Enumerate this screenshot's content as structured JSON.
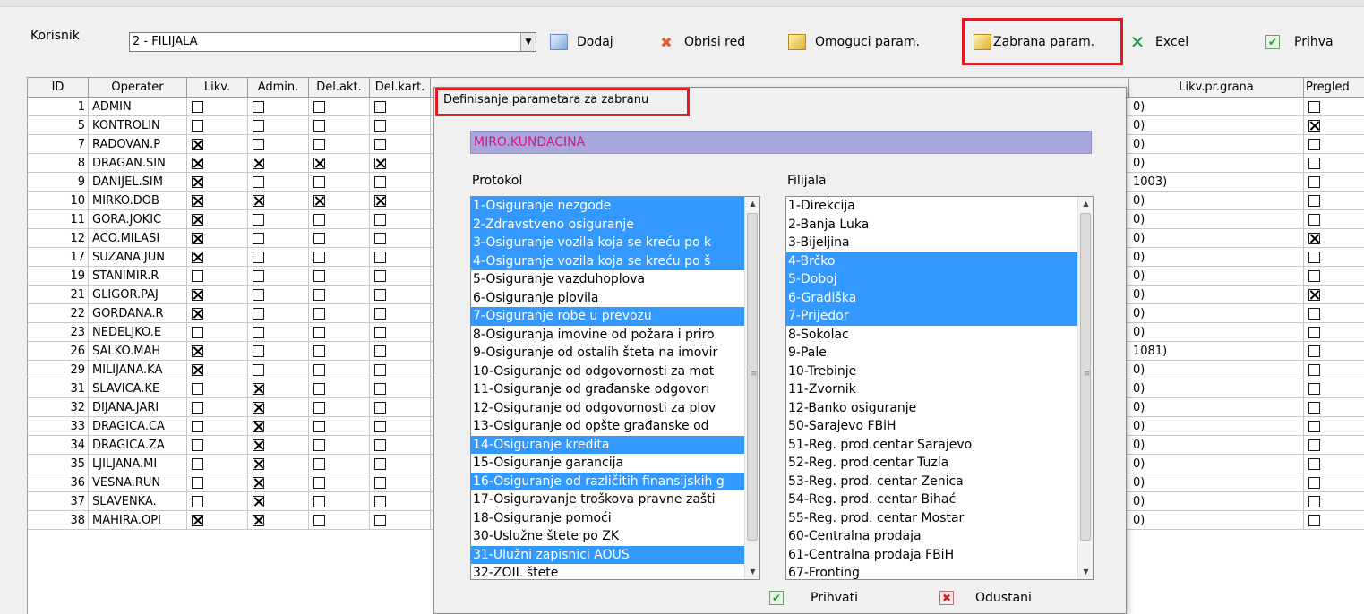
{
  "toolbar": {
    "korisnik_label": "Korisnik",
    "combo_value": "2 - FILIJALA",
    "buttons": {
      "dodaj": "Dodaj",
      "obrisi_red": "Obrisi red",
      "omoguci_param": "Omoguci param.",
      "zabrana_param": "Zabrana param.",
      "excel": "Excel",
      "prihvati": "Prihva"
    }
  },
  "grid": {
    "headers": {
      "id": "ID",
      "operater": "Operater",
      "likv": "Likv.",
      "admin": "Admin.",
      "del_akt": "Del.akt.",
      "del_kart": "Del.kart.",
      "likv_pr_grana": "Likv.pr.grana",
      "pregled": "Pregled"
    },
    "rows": [
      {
        "id": "1",
        "op": "ADMIN",
        "likv": false,
        "admin": false,
        "delakt": false,
        "delkart": false,
        "grana": "0)",
        "pregled": false
      },
      {
        "id": "5",
        "op": "KONTROLIN",
        "likv": false,
        "admin": false,
        "delakt": false,
        "delkart": false,
        "grana": "0)",
        "pregled": true
      },
      {
        "id": "7",
        "op": "RADOVAN.P",
        "likv": true,
        "admin": false,
        "delakt": false,
        "delkart": false,
        "grana": "0)",
        "pregled": false
      },
      {
        "id": "8",
        "op": "DRAGAN.SIN",
        "likv": true,
        "admin": true,
        "delakt": true,
        "delkart": true,
        "grana": "0)",
        "pregled": false
      },
      {
        "id": "9",
        "op": "DANIJEL.SIM",
        "likv": true,
        "admin": false,
        "delakt": false,
        "delkart": false,
        "grana": "1003)",
        "pregled": false
      },
      {
        "id": "10",
        "op": "MIRKO.DOB",
        "likv": true,
        "admin": true,
        "delakt": true,
        "delkart": true,
        "grana": "0)",
        "pregled": false
      },
      {
        "id": "11",
        "op": "GORA.JOKIC",
        "likv": true,
        "admin": false,
        "delakt": false,
        "delkart": false,
        "grana": "0)",
        "pregled": false
      },
      {
        "id": "12",
        "op": "ACO.MILASI",
        "likv": true,
        "admin": false,
        "delakt": false,
        "delkart": false,
        "grana": "0)",
        "pregled": true
      },
      {
        "id": "17",
        "op": "SUZANA.JUN",
        "likv": true,
        "admin": false,
        "delakt": false,
        "delkart": false,
        "grana": "0)",
        "pregled": false
      },
      {
        "id": "19",
        "op": "STANIMIR.R",
        "likv": false,
        "admin": false,
        "delakt": false,
        "delkart": false,
        "grana": "0)",
        "pregled": false
      },
      {
        "id": "21",
        "op": "GLIGOR.PAJ",
        "likv": true,
        "admin": false,
        "delakt": false,
        "delkart": false,
        "grana": "0)",
        "pregled": true
      },
      {
        "id": "22",
        "op": "GORDANA.R",
        "likv": true,
        "admin": false,
        "delakt": false,
        "delkart": false,
        "grana": "0)",
        "pregled": false
      },
      {
        "id": "23",
        "op": "NEDELJKO.E",
        "likv": false,
        "admin": false,
        "delakt": false,
        "delkart": false,
        "grana": "0)",
        "pregled": false
      },
      {
        "id": "26",
        "op": "SALKO.MAH",
        "likv": true,
        "admin": false,
        "delakt": false,
        "delkart": false,
        "grana": "1081)",
        "pregled": false
      },
      {
        "id": "29",
        "op": "MILIJANA.KA",
        "likv": true,
        "admin": false,
        "delakt": false,
        "delkart": false,
        "grana": "0)",
        "pregled": false
      },
      {
        "id": "31",
        "op": "SLAVICA.KE",
        "likv": false,
        "admin": true,
        "delakt": false,
        "delkart": false,
        "grana": "0)",
        "pregled": false
      },
      {
        "id": "32",
        "op": "DIJANA.JARI",
        "likv": false,
        "admin": true,
        "delakt": false,
        "delkart": false,
        "grana": "0)",
        "pregled": false
      },
      {
        "id": "33",
        "op": "DRAGICA.CA",
        "likv": false,
        "admin": true,
        "delakt": false,
        "delkart": false,
        "grana": "0)",
        "pregled": false
      },
      {
        "id": "34",
        "op": "DRAGICA.ZA",
        "likv": false,
        "admin": true,
        "delakt": false,
        "delkart": false,
        "grana": "0)",
        "pregled": false
      },
      {
        "id": "35",
        "op": "LJILJANA.MI",
        "likv": false,
        "admin": true,
        "delakt": false,
        "delkart": false,
        "grana": "0)",
        "pregled": false
      },
      {
        "id": "36",
        "op": "VESNA.RUN",
        "likv": false,
        "admin": true,
        "delakt": false,
        "delkart": false,
        "grana": "0)",
        "pregled": false
      },
      {
        "id": "37",
        "op": "SLAVENKA.",
        "likv": false,
        "admin": true,
        "delakt": false,
        "delkart": false,
        "grana": "0)",
        "pregled": false
      },
      {
        "id": "38",
        "op": "MAHIRA.OPI",
        "likv": true,
        "admin": true,
        "delakt": false,
        "delkart": false,
        "grana": "0)",
        "pregled": false
      }
    ]
  },
  "dialog": {
    "title": "Definisanje parametara za zabranu",
    "user_name": "MIRO.KUNDACINA",
    "protokol_label": "Protokol",
    "filijala_label": "Filijala",
    "protokol_items": [
      {
        "label": "1-Osiguranje nezgode",
        "selected": true
      },
      {
        "label": "2-Zdravstveno osiguranje",
        "selected": true
      },
      {
        "label": "3-Osiguranje vozila koja se kreću po k",
        "selected": true
      },
      {
        "label": "4-Osiguranje vozila koja se kreću po š",
        "selected": true
      },
      {
        "label": "5-Osiguranje vazduhoplova",
        "selected": false
      },
      {
        "label": "6-Osiguranje plovila",
        "selected": false
      },
      {
        "label": "7-Osiguranje robe u prevozu",
        "selected": true
      },
      {
        "label": "8-Osiguranja imovine od požara i priro",
        "selected": false
      },
      {
        "label": "9-Osiguranje od ostalih šteta na imovir",
        "selected": false
      },
      {
        "label": "10-Osiguranje od odgovornosti za mot",
        "selected": false
      },
      {
        "label": "11-Osiguranje od građanske odgovorı",
        "selected": false
      },
      {
        "label": "12-Osiguranje od odgovornosti za plov",
        "selected": false
      },
      {
        "label": "13-Osiguranje od opšte građanske od",
        "selected": false
      },
      {
        "label": "14-Osiguranje kredita",
        "selected": true
      },
      {
        "label": "15-Osiguranje garancija",
        "selected": false
      },
      {
        "label": "16-Osiguranje od različitih finansijskih g",
        "selected": true
      },
      {
        "label": "17-Osiguravanje troškova pravne zašti",
        "selected": false
      },
      {
        "label": "18-Osiguranje pomoći",
        "selected": false
      },
      {
        "label": "30-Uslužne štete po ZK",
        "selected": false
      },
      {
        "label": "31-Ulužni zapisnici AOUS",
        "selected": true
      },
      {
        "label": "32-ZOIL štete",
        "selected": false
      }
    ],
    "filijala_items": [
      {
        "label": "1-Direkcija",
        "selected": false
      },
      {
        "label": "2-Banja Luka",
        "selected": false
      },
      {
        "label": "3-Bijeljina",
        "selected": false
      },
      {
        "label": "4-Brčko",
        "selected": true
      },
      {
        "label": "5-Doboj",
        "selected": true
      },
      {
        "label": "6-Gradiška",
        "selected": true
      },
      {
        "label": "7-Prijedor",
        "selected": true
      },
      {
        "label": "8-Sokolac",
        "selected": false
      },
      {
        "label": "9-Pale",
        "selected": false
      },
      {
        "label": "10-Trebinje",
        "selected": false
      },
      {
        "label": "11-Zvornik",
        "selected": false
      },
      {
        "label": "12-Banko osiguranje",
        "selected": false
      },
      {
        "label": "50-Sarajevo FBiH",
        "selected": false
      },
      {
        "label": "51-Reg. prod.centar Sarajevo",
        "selected": false
      },
      {
        "label": "52-Reg. prod.centar Tuzla",
        "selected": false
      },
      {
        "label": "53-Reg. prod. centar Zenica",
        "selected": false
      },
      {
        "label": "54-Reg. prod. centar Bihać",
        "selected": false
      },
      {
        "label": "55-Reg. prod. centar Mostar",
        "selected": false
      },
      {
        "label": "60-Centralna prodaja",
        "selected": false
      },
      {
        "label": "61-Centralna prodaja FBiH",
        "selected": false
      },
      {
        "label": "67-Fronting",
        "selected": false
      }
    ],
    "prihvati_label": "Prihvati",
    "odustani_label": "Odustani"
  },
  "colors": {
    "highlight_red": "#e01c24",
    "selection_blue": "#3399ff",
    "name_bar_bg": "#a7a7dd",
    "name_text": "#e0128a"
  }
}
